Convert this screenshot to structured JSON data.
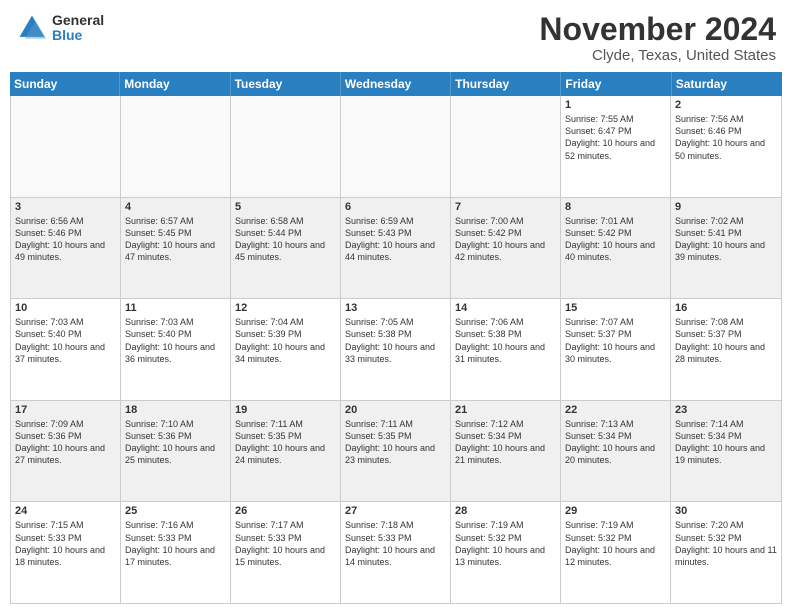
{
  "header": {
    "logo": {
      "general": "General",
      "blue": "Blue"
    },
    "title": "November 2024",
    "location": "Clyde, Texas, United States"
  },
  "weekdays": [
    "Sunday",
    "Monday",
    "Tuesday",
    "Wednesday",
    "Thursday",
    "Friday",
    "Saturday"
  ],
  "weeks": [
    [
      {
        "day": "",
        "empty": true
      },
      {
        "day": "",
        "empty": true
      },
      {
        "day": "",
        "empty": true
      },
      {
        "day": "",
        "empty": true
      },
      {
        "day": "",
        "empty": true
      },
      {
        "day": "1",
        "sunrise": "7:55 AM",
        "sunset": "6:47 PM",
        "daylight": "10 hours and 52 minutes."
      },
      {
        "day": "2",
        "sunrise": "7:56 AM",
        "sunset": "6:46 PM",
        "daylight": "10 hours and 50 minutes."
      }
    ],
    [
      {
        "day": "3",
        "sunrise": "6:56 AM",
        "sunset": "5:46 PM",
        "daylight": "10 hours and 49 minutes.",
        "shaded": true
      },
      {
        "day": "4",
        "sunrise": "6:57 AM",
        "sunset": "5:45 PM",
        "daylight": "10 hours and 47 minutes.",
        "shaded": true
      },
      {
        "day": "5",
        "sunrise": "6:58 AM",
        "sunset": "5:44 PM",
        "daylight": "10 hours and 45 minutes.",
        "shaded": true
      },
      {
        "day": "6",
        "sunrise": "6:59 AM",
        "sunset": "5:43 PM",
        "daylight": "10 hours and 44 minutes.",
        "shaded": true
      },
      {
        "day": "7",
        "sunrise": "7:00 AM",
        "sunset": "5:42 PM",
        "daylight": "10 hours and 42 minutes.",
        "shaded": true
      },
      {
        "day": "8",
        "sunrise": "7:01 AM",
        "sunset": "5:42 PM",
        "daylight": "10 hours and 40 minutes.",
        "shaded": true
      },
      {
        "day": "9",
        "sunrise": "7:02 AM",
        "sunset": "5:41 PM",
        "daylight": "10 hours and 39 minutes.",
        "shaded": true
      }
    ],
    [
      {
        "day": "10",
        "sunrise": "7:03 AM",
        "sunset": "5:40 PM",
        "daylight": "10 hours and 37 minutes."
      },
      {
        "day": "11",
        "sunrise": "7:03 AM",
        "sunset": "5:40 PM",
        "daylight": "10 hours and 36 minutes."
      },
      {
        "day": "12",
        "sunrise": "7:04 AM",
        "sunset": "5:39 PM",
        "daylight": "10 hours and 34 minutes."
      },
      {
        "day": "13",
        "sunrise": "7:05 AM",
        "sunset": "5:38 PM",
        "daylight": "10 hours and 33 minutes."
      },
      {
        "day": "14",
        "sunrise": "7:06 AM",
        "sunset": "5:38 PM",
        "daylight": "10 hours and 31 minutes."
      },
      {
        "day": "15",
        "sunrise": "7:07 AM",
        "sunset": "5:37 PM",
        "daylight": "10 hours and 30 minutes."
      },
      {
        "day": "16",
        "sunrise": "7:08 AM",
        "sunset": "5:37 PM",
        "daylight": "10 hours and 28 minutes."
      }
    ],
    [
      {
        "day": "17",
        "sunrise": "7:09 AM",
        "sunset": "5:36 PM",
        "daylight": "10 hours and 27 minutes.",
        "shaded": true
      },
      {
        "day": "18",
        "sunrise": "7:10 AM",
        "sunset": "5:36 PM",
        "daylight": "10 hours and 25 minutes.",
        "shaded": true
      },
      {
        "day": "19",
        "sunrise": "7:11 AM",
        "sunset": "5:35 PM",
        "daylight": "10 hours and 24 minutes.",
        "shaded": true
      },
      {
        "day": "20",
        "sunrise": "7:11 AM",
        "sunset": "5:35 PM",
        "daylight": "10 hours and 23 minutes.",
        "shaded": true
      },
      {
        "day": "21",
        "sunrise": "7:12 AM",
        "sunset": "5:34 PM",
        "daylight": "10 hours and 21 minutes.",
        "shaded": true
      },
      {
        "day": "22",
        "sunrise": "7:13 AM",
        "sunset": "5:34 PM",
        "daylight": "10 hours and 20 minutes.",
        "shaded": true
      },
      {
        "day": "23",
        "sunrise": "7:14 AM",
        "sunset": "5:34 PM",
        "daylight": "10 hours and 19 minutes.",
        "shaded": true
      }
    ],
    [
      {
        "day": "24",
        "sunrise": "7:15 AM",
        "sunset": "5:33 PM",
        "daylight": "10 hours and 18 minutes."
      },
      {
        "day": "25",
        "sunrise": "7:16 AM",
        "sunset": "5:33 PM",
        "daylight": "10 hours and 17 minutes."
      },
      {
        "day": "26",
        "sunrise": "7:17 AM",
        "sunset": "5:33 PM",
        "daylight": "10 hours and 15 minutes."
      },
      {
        "day": "27",
        "sunrise": "7:18 AM",
        "sunset": "5:33 PM",
        "daylight": "10 hours and 14 minutes."
      },
      {
        "day": "28",
        "sunrise": "7:19 AM",
        "sunset": "5:32 PM",
        "daylight": "10 hours and 13 minutes."
      },
      {
        "day": "29",
        "sunrise": "7:19 AM",
        "sunset": "5:32 PM",
        "daylight": "10 hours and 12 minutes."
      },
      {
        "day": "30",
        "sunrise": "7:20 AM",
        "sunset": "5:32 PM",
        "daylight": "10 hours and 11 minutes."
      }
    ]
  ]
}
